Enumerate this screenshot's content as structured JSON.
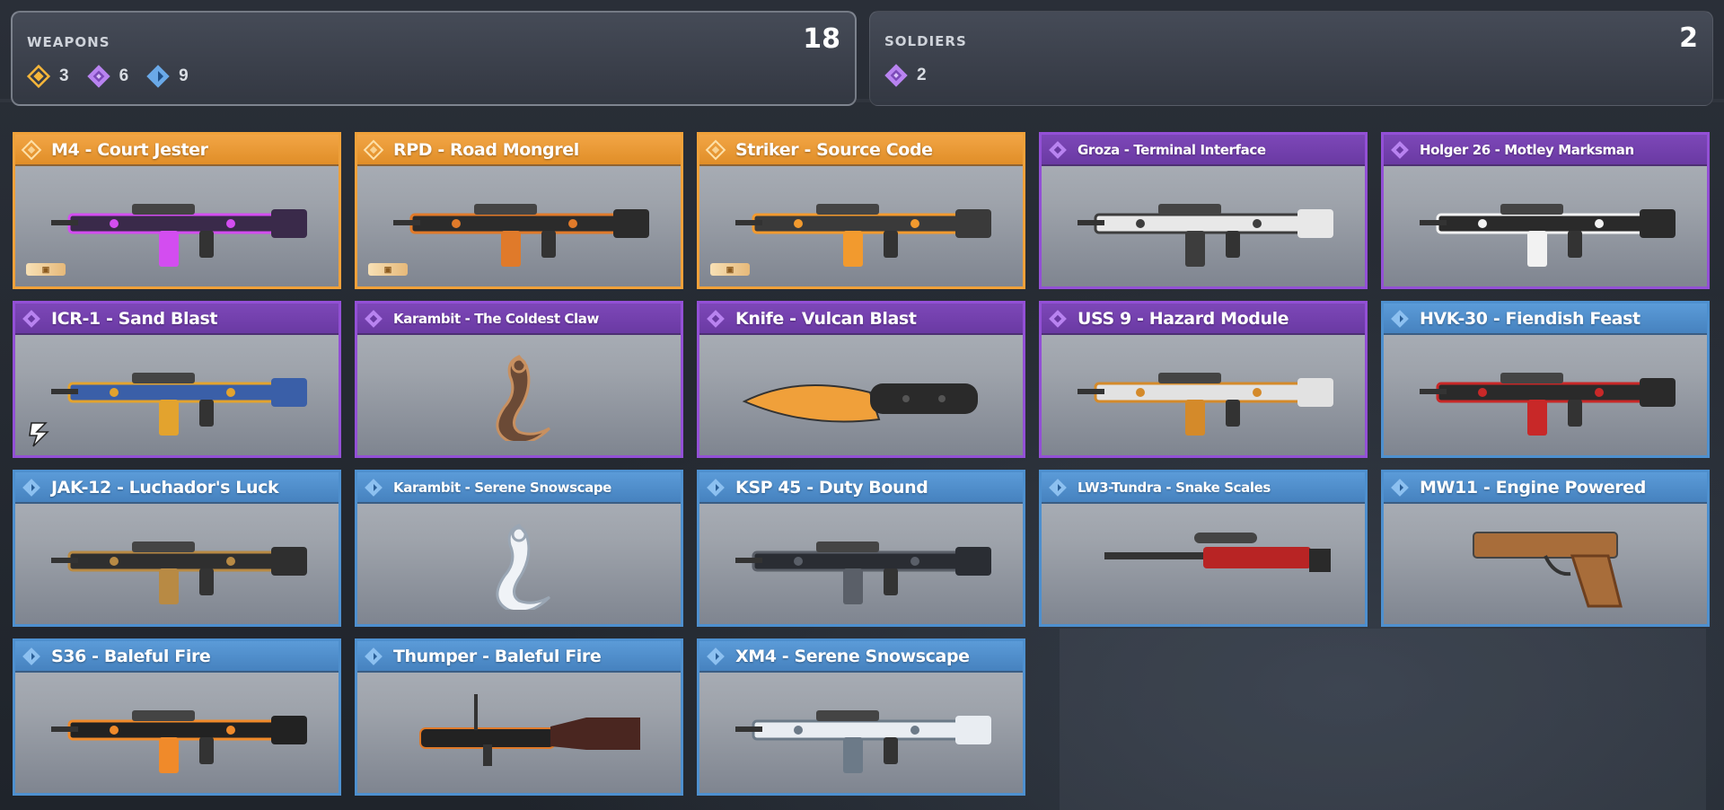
{
  "summary": {
    "weapons": {
      "label": "WEAPONS",
      "total": "18",
      "counts": [
        {
          "rarity": "legendary",
          "value": "3",
          "color": "#f5b63a"
        },
        {
          "rarity": "epic",
          "value": "6",
          "color": "#b883f0"
        },
        {
          "rarity": "rare",
          "value": "9",
          "color": "#6aa9e8"
        }
      ]
    },
    "soldiers": {
      "label": "SOLDIERS",
      "total": "2",
      "counts": [
        {
          "rarity": "epic",
          "value": "2",
          "color": "#b883f0"
        }
      ]
    }
  },
  "colors": {
    "legendary": "#f0a13a",
    "epic": "#9350d6",
    "rare": "#4e90cf"
  },
  "cards": [
    {
      "name": "M4 - Court Jester",
      "rarity": "legendary",
      "badge": "tag",
      "art": "rifle-violet"
    },
    {
      "name": "RPD - Road Mongrel",
      "rarity": "legendary",
      "badge": "tag",
      "art": "lmg-motorbike"
    },
    {
      "name": "Striker - Source Code",
      "rarity": "legendary",
      "badge": "tag",
      "art": "shotgun-orange"
    },
    {
      "name": "Groza - Terminal Interface",
      "rarity": "epic",
      "art": "bullpup-white"
    },
    {
      "name": "Holger 26 - Motley Marksman",
      "rarity": "epic",
      "art": "rifle-checker"
    },
    {
      "name": "ICR-1 - Sand Blast",
      "rarity": "epic",
      "badge": "season",
      "art": "rifle-blue-gold"
    },
    {
      "name": "Karambit - The Coldest Claw",
      "rarity": "epic",
      "art": "karambit-bronze"
    },
    {
      "name": "Knife - Vulcan Blast",
      "rarity": "epic",
      "art": "knife-orange"
    },
    {
      "name": "USS 9 - Hazard Module",
      "rarity": "epic",
      "art": "smg-white"
    },
    {
      "name": "HVK-30 - Fiendish Feast",
      "rarity": "rare",
      "art": "rifle-red"
    },
    {
      "name": "JAK-12 - Luchador's Luck",
      "rarity": "rare",
      "art": "shotgun-gold"
    },
    {
      "name": "Karambit - Serene Snowscape",
      "rarity": "rare",
      "art": "karambit-white"
    },
    {
      "name": "KSP 45 - Duty Bound",
      "rarity": "rare",
      "art": "smg-dark"
    },
    {
      "name": "LW3-Tundra - Snake Scales",
      "rarity": "rare",
      "art": "sniper-red"
    },
    {
      "name": "MW11 - Engine Powered",
      "rarity": "rare",
      "art": "pistol-bronze"
    },
    {
      "name": "S36 - Baleful Fire",
      "rarity": "rare",
      "art": "rifle-fire"
    },
    {
      "name": "Thumper - Baleful Fire",
      "rarity": "rare",
      "art": "launcher-fire"
    },
    {
      "name": "XM4 - Serene Snowscape",
      "rarity": "rare",
      "art": "rifle-snow"
    }
  ]
}
